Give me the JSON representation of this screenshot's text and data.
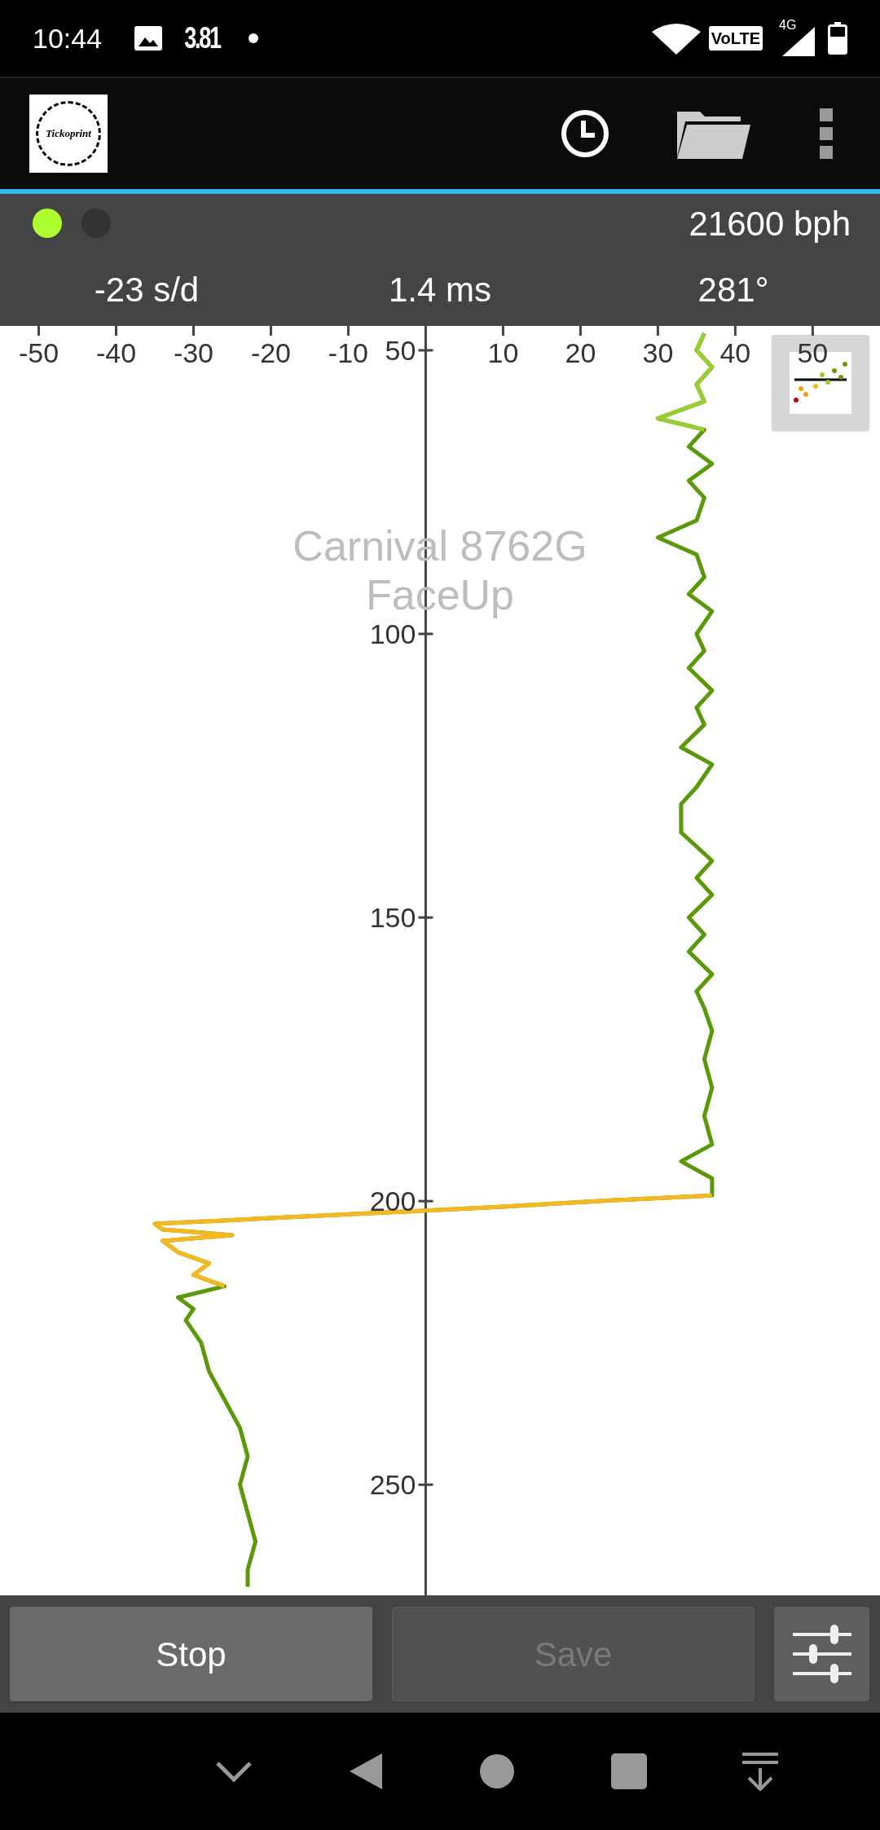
{
  "status_bar": {
    "time": "10:44",
    "notification_text": "3.81",
    "network": "4G",
    "volte": "VoLTE"
  },
  "toolbar": {
    "logo_text": "Tickoprint"
  },
  "header": {
    "indicators": [
      {
        "color": "#adff2f"
      },
      {
        "color": "#333333"
      }
    ],
    "beat_rate": "21600 bph",
    "readings": [
      "-23 s/d",
      "1.4 ms",
      "281°"
    ]
  },
  "chart": {
    "label_lines": [
      "Carnival 8762G",
      "FaceUp"
    ],
    "chart_data": {
      "type": "line",
      "orientation": "horizontal",
      "xlim": [
        -55,
        58.7
      ],
      "ylim": [
        269.5,
        45.7
      ],
      "xticks": [
        -50,
        -40,
        -30,
        -20,
        -10,
        10,
        20,
        30,
        40,
        50
      ],
      "yticks": [
        50,
        100,
        150,
        200,
        250
      ],
      "x": [
        47,
        50,
        53,
        56,
        59,
        62,
        64,
        67,
        70,
        73,
        76,
        80,
        83,
        86,
        90,
        93,
        96,
        100,
        103,
        106,
        110,
        113,
        116,
        120,
        123,
        127,
        130,
        135,
        140,
        143,
        146,
        150,
        153,
        156,
        160,
        163,
        166,
        170,
        175,
        180,
        185,
        190,
        193,
        196,
        199,
        200,
        201,
        202,
        203,
        204,
        205,
        206,
        207,
        209,
        211,
        213,
        215,
        217,
        219,
        221,
        225,
        230,
        235,
        240,
        245,
        250,
        255,
        260,
        265,
        268
      ],
      "series": [
        {
          "color": "#5a9a0a",
          "values": [
            36,
            35,
            37,
            35,
            36,
            30,
            36,
            34,
            37,
            34,
            36,
            35,
            30,
            35,
            36,
            34,
            37,
            35,
            36,
            34,
            37,
            35,
            36,
            33,
            37,
            35,
            33,
            33,
            37,
            35,
            37,
            34,
            36,
            34,
            37,
            35,
            36,
            37,
            36,
            37,
            36,
            37,
            33,
            37,
            37,
            22,
            10,
            -5,
            -20,
            -35,
            -34,
            -25,
            -34,
            -32,
            -28,
            -30,
            -26,
            -32,
            -30,
            -31,
            -29,
            -28,
            -26,
            -24,
            -23,
            -24,
            -23,
            -22,
            -23,
            -23
          ]
        },
        {
          "color": "#9acd32",
          "values": [
            36,
            35,
            37,
            35,
            36,
            30,
            36,
            null,
            null,
            null,
            null,
            null,
            null,
            null,
            null,
            null,
            null,
            null,
            null,
            null,
            null,
            null,
            null,
            null,
            null,
            null,
            null,
            null,
            null,
            null,
            null,
            null,
            null,
            null,
            null,
            null,
            null,
            null,
            null,
            null,
            null,
            null,
            null,
            null,
            null,
            null,
            null,
            null,
            null,
            null,
            null,
            null,
            null,
            null,
            null,
            null,
            null,
            null,
            null,
            null,
            null,
            null,
            null,
            null,
            null,
            null,
            null,
            null,
            null,
            null
          ]
        },
        {
          "color": "#f5b820",
          "values": [
            null,
            null,
            null,
            null,
            null,
            null,
            null,
            null,
            null,
            null,
            null,
            null,
            null,
            null,
            null,
            null,
            null,
            null,
            null,
            null,
            null,
            null,
            null,
            null,
            null,
            null,
            null,
            null,
            null,
            null,
            null,
            null,
            null,
            null,
            null,
            null,
            null,
            null,
            null,
            null,
            null,
            null,
            null,
            null,
            37,
            22,
            10,
            -5,
            -20,
            -35,
            -34,
            -25,
            -34,
            -32,
            -28,
            -30,
            -26,
            null,
            null,
            null,
            null,
            null,
            null,
            null,
            null,
            null,
            null,
            null,
            null,
            null
          ]
        }
      ]
    }
  },
  "buttons": [
    {
      "label": "Stop",
      "disabled": false
    },
    {
      "label": "Save",
      "disabled": true
    }
  ]
}
